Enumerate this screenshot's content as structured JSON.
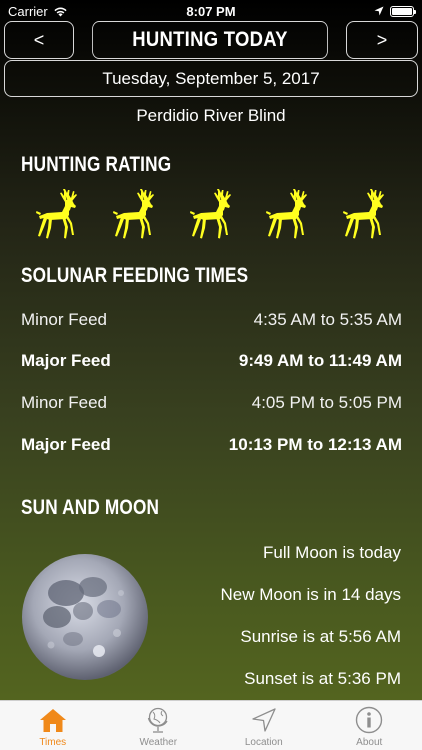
{
  "status": {
    "carrier": "Carrier",
    "time": "8:07 PM"
  },
  "nav": {
    "prev_label": "<",
    "title": "HUNTING TODAY",
    "next_label": ">"
  },
  "date": "Tuesday, September 5, 2017",
  "location": "Perdidio River Blind",
  "rating": {
    "title": "HUNTING RATING",
    "stars": 5,
    "max": 5,
    "color": "#ffff1f"
  },
  "solunar": {
    "title": "SOLUNAR FEEDING TIMES",
    "rows": [
      {
        "label": "Minor Feed",
        "time": "4:35 AM to 5:35 AM"
      },
      {
        "label": "Major Feed",
        "time": "9:49 AM to 11:49 AM"
      },
      {
        "label": "Minor Feed",
        "time": "4:05 PM to 5:05 PM"
      },
      {
        "label": "Major Feed",
        "time": "10:13 PM to 12:13 AM"
      }
    ]
  },
  "sun_moon": {
    "title": "SUN AND MOON",
    "lines": [
      "Full Moon is today",
      "New Moon is in 14 days",
      "Sunrise is at 5:56 AM",
      "Sunset is at 5:36 PM"
    ]
  },
  "tabs": [
    {
      "label": "Times",
      "icon": "home-icon"
    },
    {
      "label": "Weather",
      "icon": "globe-icon"
    },
    {
      "label": "Location",
      "icon": "location-arrow-icon"
    },
    {
      "label": "About",
      "icon": "info-icon"
    }
  ],
  "colors": {
    "active_tab": "#f0891a",
    "inactive_tab": "#8e8e8e"
  }
}
